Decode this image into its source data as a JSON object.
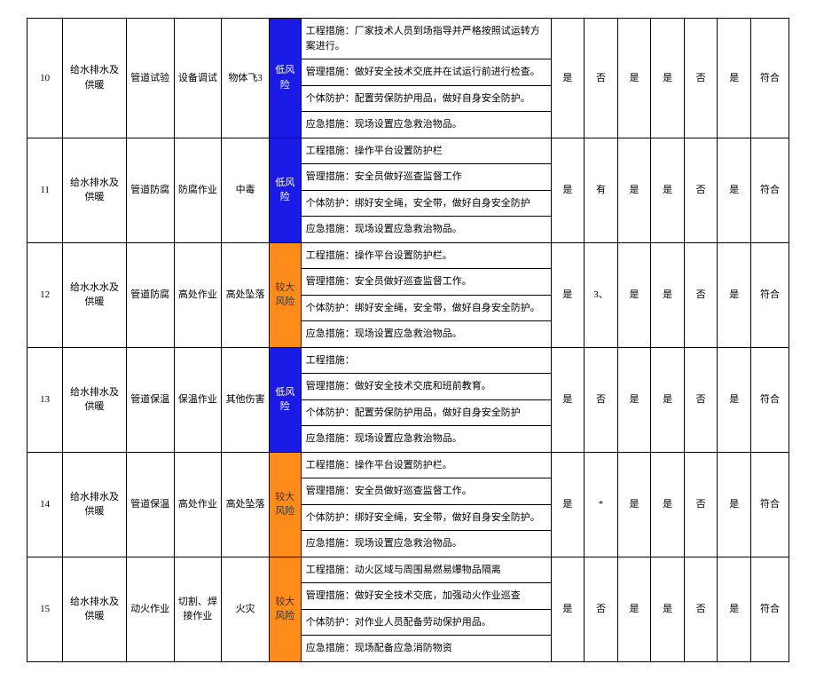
{
  "rows": [
    {
      "idx": "10",
      "category": "给水排水及供暖",
      "subcategory": "管道试验",
      "activity": "设备调试",
      "hazard": "物体飞3",
      "risk_label": "低风险",
      "risk_class": "risk-blue",
      "measures": [
        "工程措施：厂家技术人员到场指导并严格按照试运转方案进行。",
        "管理措施：做好安全技术交底并在试运行前进行检查。",
        "个体防护：配置劳保防护用品，做好自身安全防护。",
        "应急措施：现场设置应急救治物品。"
      ],
      "cols": [
        "是",
        "否",
        "是",
        "是",
        "否",
        "是",
        "符合"
      ]
    },
    {
      "idx": "11",
      "category": "给水排水及供暖",
      "subcategory": "管道防腐",
      "activity": "防腐作业",
      "hazard": "中毒",
      "risk_label": "低风险",
      "risk_class": "risk-blue",
      "measures": [
        "工程措施：操作平台设置防护栏",
        "管理措施：安全员做好巡查监督工作",
        "个体防护：绑好安全绳，安全带，做好自身安全防护",
        "应急措施：现场设置应急救治物品。"
      ],
      "cols": [
        "是",
        "有",
        "是",
        "是",
        "否",
        "是",
        "符合"
      ]
    },
    {
      "idx": "12",
      "category": "给水水水及供暖",
      "subcategory": "管道防腐",
      "activity": "高处作业",
      "hazard": "高处坠落",
      "risk_label": "较大风险",
      "risk_class": "risk-orange",
      "measures": [
        "工程措施：操作平台设置防护栏。",
        "管理措施：安全员做好巡查监督工作。",
        "个体防护：绑好安全绳，安全带，做好自身安全防护。",
        "应急措施：现场设置应急救治物品。"
      ],
      "cols": [
        "是",
        "3、",
        "是",
        "是",
        "否",
        "是",
        "符合"
      ]
    },
    {
      "idx": "13",
      "category": "给水排水及供暖",
      "subcategory": "管道保温",
      "activity": "保温作业",
      "hazard": "其他伤害",
      "risk_label": "低风险",
      "risk_class": "risk-blue",
      "measures": [
        "工程措施：",
        "管理措施：做好安全技术交底和班前教育。",
        "个体防护：配置劳保防护用品，做好自身安全防护",
        "应急措施：现场设置应急救治物品。"
      ],
      "cols": [
        "是",
        "否",
        "是",
        "是",
        "否",
        "是",
        "符合"
      ]
    },
    {
      "idx": "14",
      "category": "给水排水及供暖",
      "subcategory": "管道保温",
      "activity": "高处作业",
      "hazard": "高处坠落",
      "risk_label": "较大风险",
      "risk_class": "risk-orange",
      "measures": [
        "工程措施：操作平台设置防护栏。",
        "管理措施：安全员做好巡查监督工作。",
        "个体防护：绑好安全绳，安全带，做好自身安全防护。",
        "应急措施：现场设置应急救治物品。"
      ],
      "cols": [
        "是",
        "*",
        "是",
        "是",
        "否",
        "是",
        "符合"
      ]
    },
    {
      "idx": "15",
      "category": "给水排水及供暖",
      "subcategory": "动火作业",
      "activity": "切割、焊接作业",
      "hazard": "火灾",
      "risk_label": "较大风险",
      "risk_class": "risk-orange",
      "measures": [
        "工程措施：动火区域与周围易燃易爆物品隔离",
        "管理措施：做好安全技术交底，加强动火作业巡查",
        "个体防护：对作业人员配备劳动保护用品。",
        "应急措施：现场配备应急消防物资"
      ],
      "cols": [
        "是",
        "否",
        "是",
        "是",
        "否",
        "是",
        "符合"
      ]
    }
  ]
}
